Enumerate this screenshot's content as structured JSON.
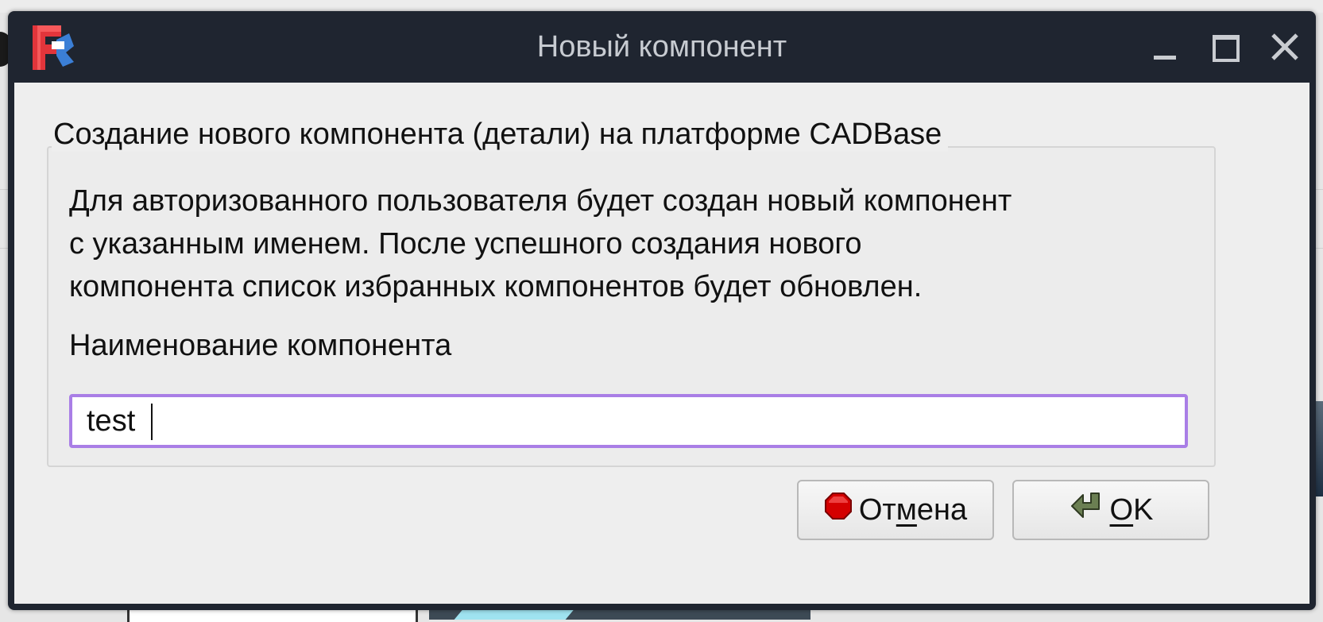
{
  "dialog": {
    "title": "Новый компонент",
    "group_title": "Создание нового компонента (детали) на платформе CADBase",
    "description": "Для авторизованного пользователя будет создан новый компонент\nс указанным именем. После успешного создания нового\nкомпонента список избранных компонентов будет обновлен.",
    "field_label": "Наименование компонента",
    "name_value": "test",
    "cancel": {
      "pre": "От",
      "mnemonic": "м",
      "post": "ена",
      "icon": "stop-icon"
    },
    "ok": {
      "pre": "",
      "mnemonic": "O",
      "post": "K",
      "icon": "enter-arrow-icon"
    }
  },
  "window_controls": [
    "minimize-icon",
    "maximize-icon",
    "close-icon"
  ],
  "colors": {
    "titlebar": "#1f2530",
    "title_text": "#c7cbd1",
    "input_focus_border": "#a97ee6",
    "stop_red": "#d40000",
    "arrow_green": "#6b7f52"
  }
}
